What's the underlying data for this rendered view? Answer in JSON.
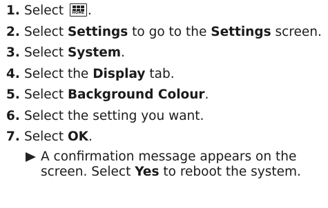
{
  "steps": [
    {
      "num": "1.",
      "pre": "Select",
      "icon": "home-button-icon",
      "icon_label": "HOME",
      "post": "."
    },
    {
      "num": "2.",
      "pre": "Select ",
      "b1": "Settings",
      "mid": " to go to the ",
      "b2": "Settings",
      "post": " screen."
    },
    {
      "num": "3.",
      "pre": "Select ",
      "b1": "System",
      "post": "."
    },
    {
      "num": "4.",
      "pre": "Select the ",
      "b1": "Display",
      "post": " tab."
    },
    {
      "num": "5.",
      "pre": "Select ",
      "b1": "Background Colour",
      "post": "."
    },
    {
      "num": "6.",
      "text": "Select the setting you want."
    },
    {
      "num": "7.",
      "pre": "Select ",
      "b1": "OK",
      "post": "."
    }
  ],
  "result": {
    "icon": "triangle-arrow-icon",
    "pre": "A confirmation message appears on the screen. Select ",
    "bold": "Yes",
    "post": " to reboot the system."
  }
}
